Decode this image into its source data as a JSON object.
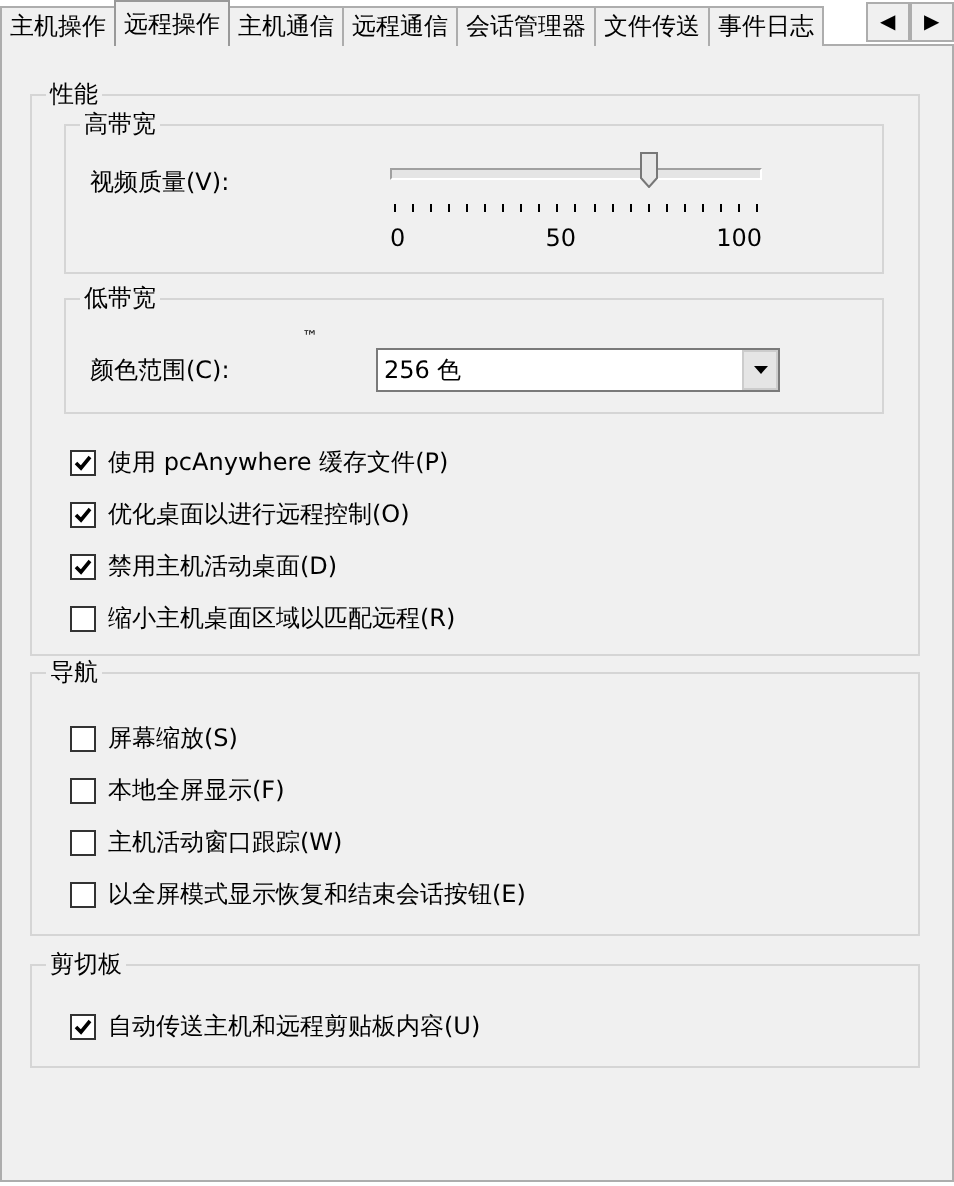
{
  "tabs": [
    {
      "label": "主机操作",
      "selected": false
    },
    {
      "label": "远程操作",
      "selected": true
    },
    {
      "label": "主机通信",
      "selected": false
    },
    {
      "label": "远程通信",
      "selected": false
    },
    {
      "label": "会话管理器",
      "selected": false
    },
    {
      "label": "文件传送",
      "selected": false
    },
    {
      "label": "事件日志",
      "selected": false
    }
  ],
  "tab_scroll": [
    "◀",
    "▶"
  ],
  "performance": {
    "title": "性能",
    "high_bandwidth": {
      "title": "高带宽",
      "slider": {
        "label": "视频质量(V):",
        "level": 0.7,
        "scale": [
          "0",
          "50",
          "100"
        ]
      }
    },
    "low_bandwidth": {
      "title": "低带宽",
      "mark": "™",
      "dropdown": {
        "label": "颜色范围(C):",
        "value": "256 色"
      }
    },
    "options": [
      {
        "label": "使用 pcAnywhere 缓存文件(P)",
        "checked": true
      },
      {
        "label": "优化桌面以进行远程控制(O)",
        "checked": true
      },
      {
        "label": "禁用主机活动桌面(D)",
        "checked": true
      },
      {
        "label": "缩小主机桌面区域以匹配远程(R)",
        "checked": false
      }
    ]
  },
  "navigation": {
    "title": "导航",
    "options": [
      {
        "label": "屏幕缩放(S)",
        "checked": false
      },
      {
        "label": "本地全屏显示(F)",
        "checked": false
      },
      {
        "label": "主机活动窗口跟踪(W)",
        "checked": false
      },
      {
        "label": "以全屏模式显示恢复和结束会话按钮(E)",
        "checked": false
      }
    ]
  },
  "clipboard": {
    "title": "剪切板",
    "options": [
      {
        "label": "自动传送主机和远程剪贴板内容(U)",
        "checked": true
      }
    ]
  }
}
